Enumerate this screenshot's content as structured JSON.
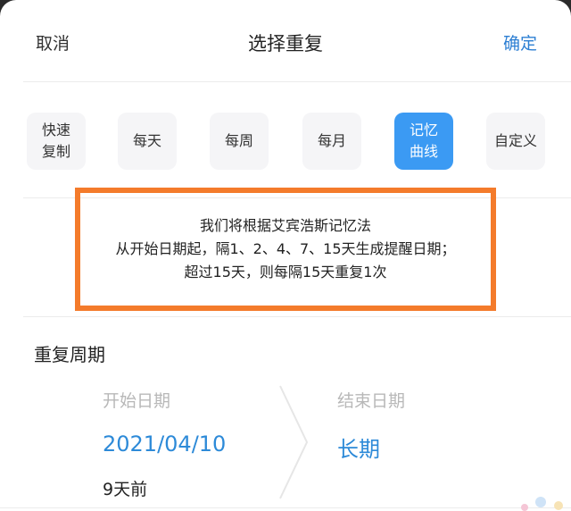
{
  "header": {
    "cancel_label": "取消",
    "title": "选择重复",
    "confirm_label": "确定"
  },
  "options": [
    {
      "label": "快速\n复制",
      "active": false
    },
    {
      "label": "每天",
      "active": false
    },
    {
      "label": "每周",
      "active": false
    },
    {
      "label": "每月",
      "active": false
    },
    {
      "label": "记忆\n曲线",
      "active": true
    },
    {
      "label": "自定义",
      "active": false
    }
  ],
  "note": {
    "line1": "我们将根据艾宾浩斯记忆法",
    "line2": "从开始日期起，隔1、2、4、7、15天生成提醒日期；",
    "line3": "超过15天，则每隔15天重复1次"
  },
  "period": {
    "section_title": "重复周期",
    "start_label": "开始日期",
    "start_value": "2021/04/10",
    "start_sub": "9天前",
    "end_label": "结束日期",
    "end_value": "长期"
  },
  "colors": {
    "accent": "#2d8ad8",
    "active_option": "#3b9af3",
    "highlight_border": "#f47b2b"
  }
}
